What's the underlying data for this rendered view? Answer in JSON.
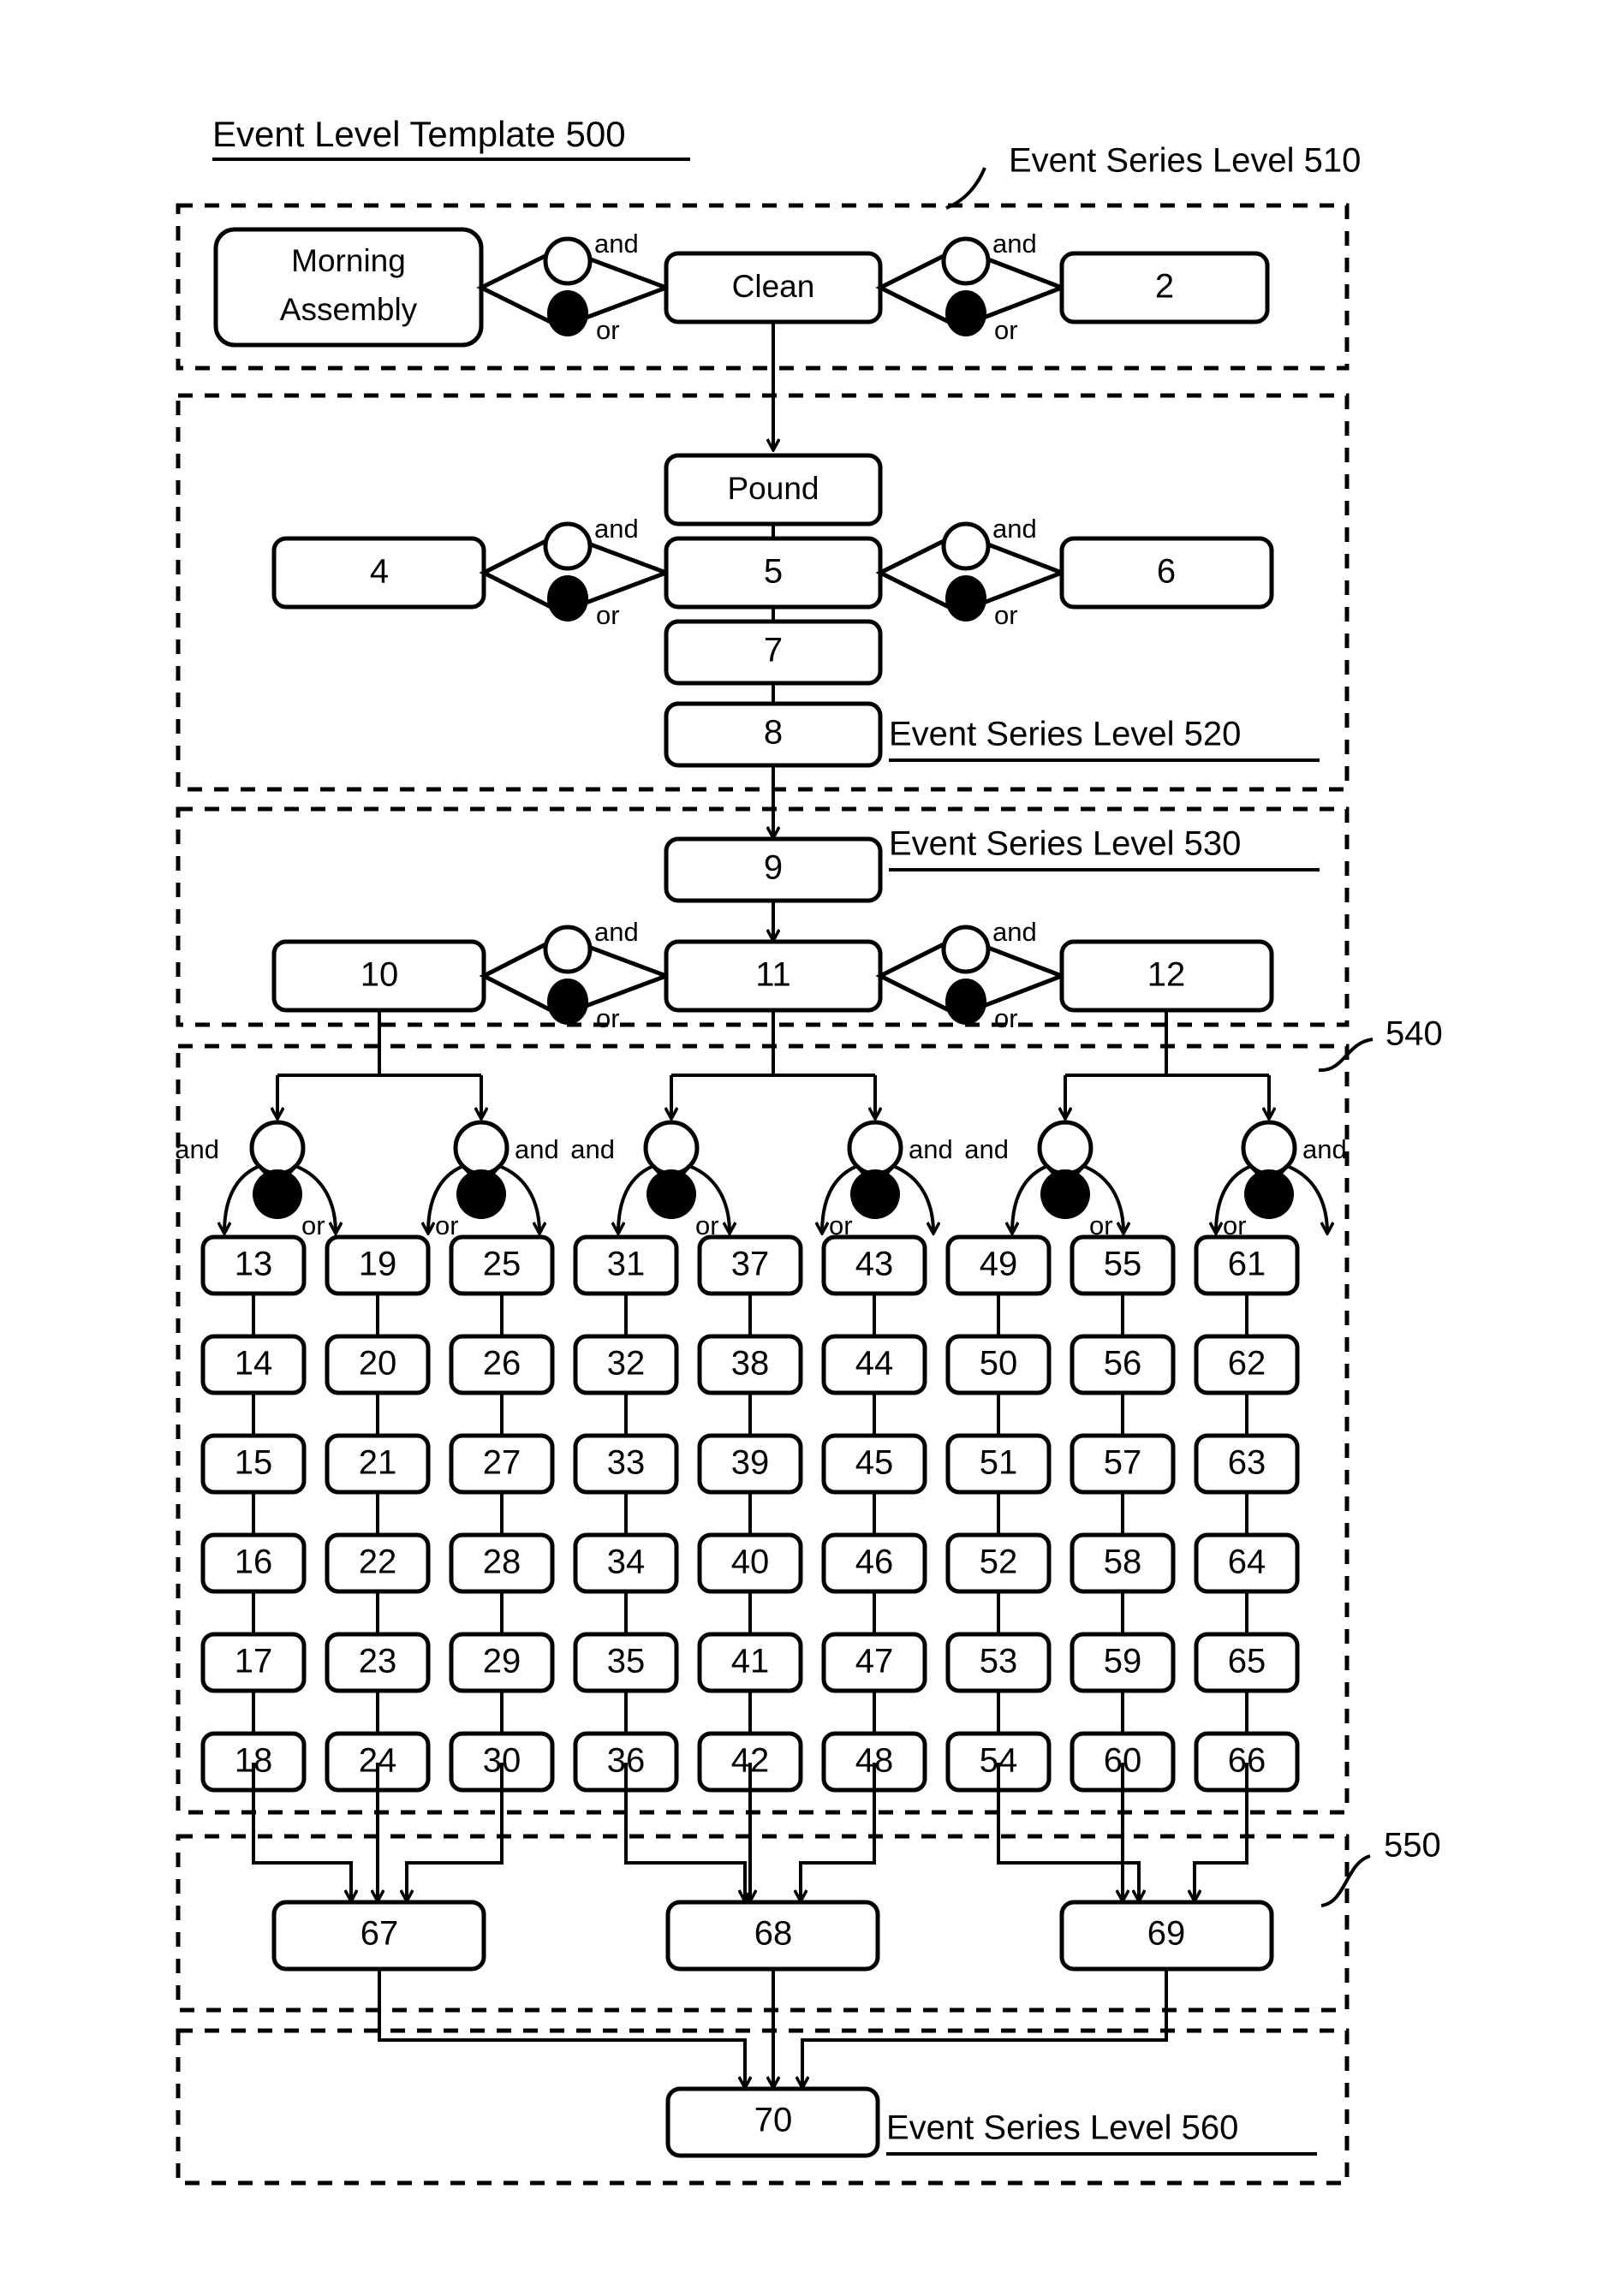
{
  "title": "Event Level Template 500",
  "sections": [
    {
      "id": "510",
      "label": "Event Series Level 510",
      "label_position": "outside-top-right"
    },
    {
      "id": "520",
      "label": "Event Series Level 520",
      "label_position": "inside-bottom-right"
    },
    {
      "id": "530",
      "label": "Event Series Level 530",
      "label_position": "inside-top-right"
    },
    {
      "id": "540",
      "label": "540",
      "label_position": "outside-right"
    },
    {
      "id": "550",
      "label": "550",
      "label_position": "outside-right"
    },
    {
      "id": "560",
      "label": "Event Series Level 560",
      "label_position": "inside-right"
    }
  ],
  "operators": {
    "and": "and",
    "or": "or"
  },
  "level_510": {
    "nodes": [
      {
        "id": "morning-assembly",
        "label": "Morning\nAssembly",
        "line1": "Morning",
        "line2": "Assembly"
      },
      {
        "id": "clean",
        "label": "Clean"
      },
      {
        "id": "n2",
        "label": "2"
      }
    ]
  },
  "level_520": {
    "nodes": [
      {
        "id": "pound",
        "label": "Pound"
      },
      {
        "id": "n4",
        "label": "4"
      },
      {
        "id": "n5",
        "label": "5"
      },
      {
        "id": "n6",
        "label": "6"
      },
      {
        "id": "n7",
        "label": "7"
      },
      {
        "id": "n8",
        "label": "8"
      }
    ]
  },
  "level_530": {
    "nodes": [
      {
        "id": "n9",
        "label": "9"
      },
      {
        "id": "n10",
        "label": "10"
      },
      {
        "id": "n11",
        "label": "11"
      },
      {
        "id": "n12",
        "label": "12"
      }
    ]
  },
  "level_540": {
    "columns": [
      {
        "index": 0,
        "values": [
          "13",
          "14",
          "15",
          "16",
          "17",
          "18"
        ]
      },
      {
        "index": 1,
        "values": [
          "19",
          "20",
          "21",
          "22",
          "23",
          "24"
        ]
      },
      {
        "index": 2,
        "values": [
          "25",
          "26",
          "27",
          "28",
          "29",
          "30"
        ]
      },
      {
        "index": 3,
        "values": [
          "31",
          "32",
          "33",
          "34",
          "35",
          "36"
        ]
      },
      {
        "index": 4,
        "values": [
          "37",
          "38",
          "39",
          "40",
          "41",
          "42"
        ]
      },
      {
        "index": 5,
        "values": [
          "43",
          "44",
          "45",
          "46",
          "47",
          "48"
        ]
      },
      {
        "index": 6,
        "values": [
          "49",
          "50",
          "51",
          "52",
          "53",
          "54"
        ]
      },
      {
        "index": 7,
        "values": [
          "55",
          "56",
          "57",
          "58",
          "59",
          "60"
        ]
      },
      {
        "index": 8,
        "values": [
          "61",
          "62",
          "63",
          "64",
          "65",
          "66"
        ]
      }
    ],
    "splitters": [
      {
        "id": "sp0",
        "and_side": "left"
      },
      {
        "id": "sp1",
        "and_side": "right"
      },
      {
        "id": "sp2",
        "and_side": "left"
      },
      {
        "id": "sp3",
        "and_side": "right"
      },
      {
        "id": "sp4",
        "and_side": "left"
      },
      {
        "id": "sp5",
        "and_side": "right"
      }
    ]
  },
  "level_550": {
    "nodes": [
      {
        "id": "n67",
        "label": "67"
      },
      {
        "id": "n68",
        "label": "68"
      },
      {
        "id": "n69",
        "label": "69"
      }
    ]
  },
  "level_560": {
    "nodes": [
      {
        "id": "n70",
        "label": "70"
      }
    ]
  },
  "colors": {
    "stroke": "#000000",
    "fill": "#ffffff",
    "background": "#ffffff"
  }
}
